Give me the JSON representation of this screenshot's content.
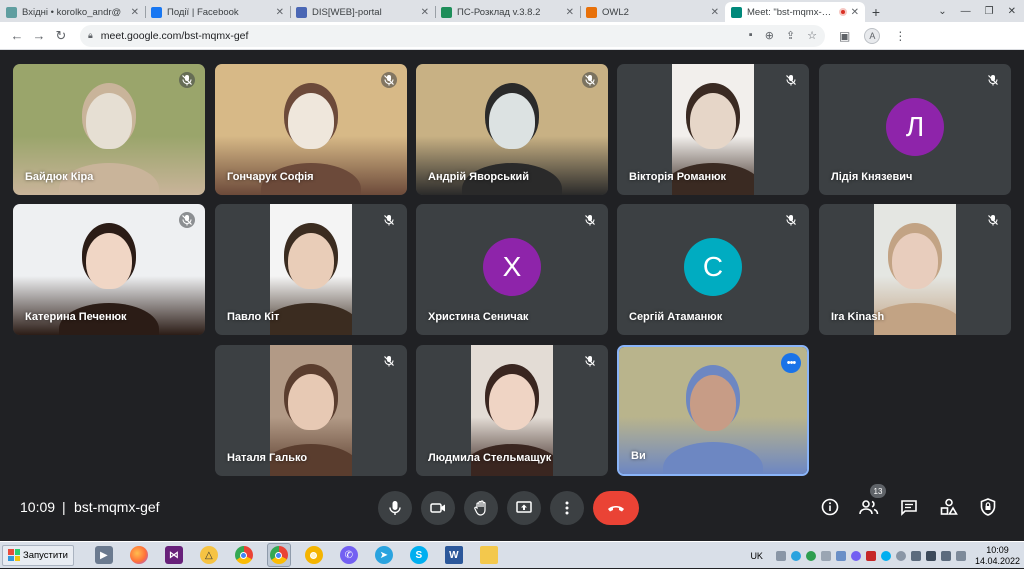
{
  "browser": {
    "tabs": [
      {
        "title": "Вхідні • korolko_andr@",
        "icon_color": "#5f9ea0",
        "active": false
      },
      {
        "title": "Події | Facebook",
        "icon_color": "#1877f2",
        "active": false
      },
      {
        "title": "DIS[WEB]-portal",
        "icon_color": "#4a67b5",
        "active": false
      },
      {
        "title": "ПС-Розклад v.3.8.2",
        "icon_color": "#1e8e5a",
        "active": false
      },
      {
        "title": "OWL2",
        "icon_color": "#e8710a",
        "active": false
      },
      {
        "title": "Meet: \"bst-mqmx-gef\"",
        "icon_color": "#00897b",
        "active": true
      }
    ],
    "url": "meet.google.com/bst-mqmx-gef",
    "profile_initial": "A"
  },
  "participants": [
    {
      "name": "Байдюк Кіра",
      "type": "video",
      "colors": [
        "#9aa56b",
        "#e6dfd3",
        "#c9b49a"
      ]
    },
    {
      "name": "Гончарук Софія",
      "type": "video",
      "colors": [
        "#d7b987",
        "#efe7dc",
        "#6c4a3a"
      ]
    },
    {
      "name": "Андрій Яворський",
      "type": "video",
      "colors": [
        "#c8b184",
        "#dce2e2",
        "#2a2a2a"
      ]
    },
    {
      "name": "Вікторія Романюк",
      "type": "video-mid",
      "colors": [
        "#f2efec",
        "#e6d6c8",
        "#3a2a22"
      ]
    },
    {
      "name": "Лідія Князевич",
      "type": "avatar",
      "initial": "Л",
      "avatar_color": "#8e24aa"
    },
    {
      "name": "Катерина Печенюк",
      "type": "video",
      "colors": [
        "#eef0f2",
        "#f0d6c5",
        "#2b1c16"
      ]
    },
    {
      "name": "Павло Кіт",
      "type": "video-mid",
      "colors": [
        "#f4f4f4",
        "#e9cdb8",
        "#3b2c20"
      ]
    },
    {
      "name": "Христина Сеничак",
      "type": "avatar",
      "initial": "Х",
      "avatar_color": "#8e24aa"
    },
    {
      "name": "Сергій Атаманюк",
      "type": "avatar",
      "initial": "С",
      "avatar_color": "#00acc1"
    },
    {
      "name": "Ira Kinash",
      "type": "video-mid",
      "colors": [
        "#e4e6e2",
        "#e8cdbd",
        "#c2a384"
      ]
    },
    {
      "name": "Наталя Галько",
      "type": "video-mid",
      "colors": [
        "#b29a86",
        "#e7c9b4",
        "#5a3d2e"
      ]
    },
    {
      "name": "Людмила Стельмащук",
      "type": "video-mid",
      "colors": [
        "#e3dcd5",
        "#efd4c4",
        "#3a2620"
      ]
    },
    {
      "name": "Ви",
      "type": "video-self",
      "colors": [
        "#b9b48c",
        "#c79c86",
        "#6d87c2"
      ]
    }
  ],
  "meeting": {
    "time": "10:09",
    "separator": "|",
    "code": "bst-mqmx-gef",
    "participant_count": "13"
  },
  "controls": {
    "mic_icon": "mic-icon",
    "camera_icon": "camera-icon",
    "hand_icon": "raise-hand-icon",
    "present_icon": "present-icon",
    "more_icon": "more-options-icon",
    "end_icon": "end-call-icon",
    "end_color": "#ea4335"
  },
  "taskbar": {
    "start_label": "Запустити",
    "lang": "UK",
    "time": "10:09",
    "date": "14.04.2022"
  }
}
